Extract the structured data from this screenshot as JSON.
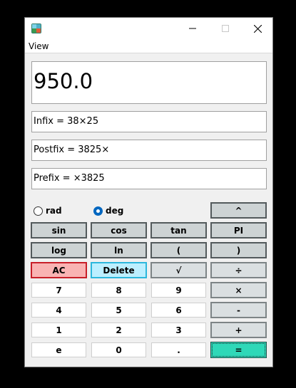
{
  "menu": {
    "view": "View"
  },
  "display": {
    "value": "950.0"
  },
  "expressions": {
    "infix": "Infix = 38×25",
    "postfix": "Postfix = 3825×",
    "prefix": "Prefix = ×3825"
  },
  "angle_mode": {
    "rad": {
      "label": "rad",
      "selected": false
    },
    "deg": {
      "label": "deg",
      "selected": true
    }
  },
  "buttons": {
    "pow": "^",
    "sin": "sin",
    "cos": "cos",
    "tan": "tan",
    "pi": "PI",
    "log": "log",
    "ln": "ln",
    "lparen": "(",
    "rparen": ")",
    "ac": "AC",
    "delete": "Delete",
    "sqrt": "√",
    "div": "÷",
    "d7": "7",
    "d8": "8",
    "d9": "9",
    "mul": "×",
    "d4": "4",
    "d5": "5",
    "d6": "6",
    "sub": "-",
    "d1": "1",
    "d2": "2",
    "d3": "3",
    "add": "+",
    "e": "e",
    "d0": "0",
    "dot": ".",
    "eq": "="
  },
  "colors": {
    "ac_bg": "#f9b3b3",
    "delete_bg": "#bcefff",
    "equals_bg": "#2fd8b8",
    "radio_accent": "#0067c0"
  }
}
